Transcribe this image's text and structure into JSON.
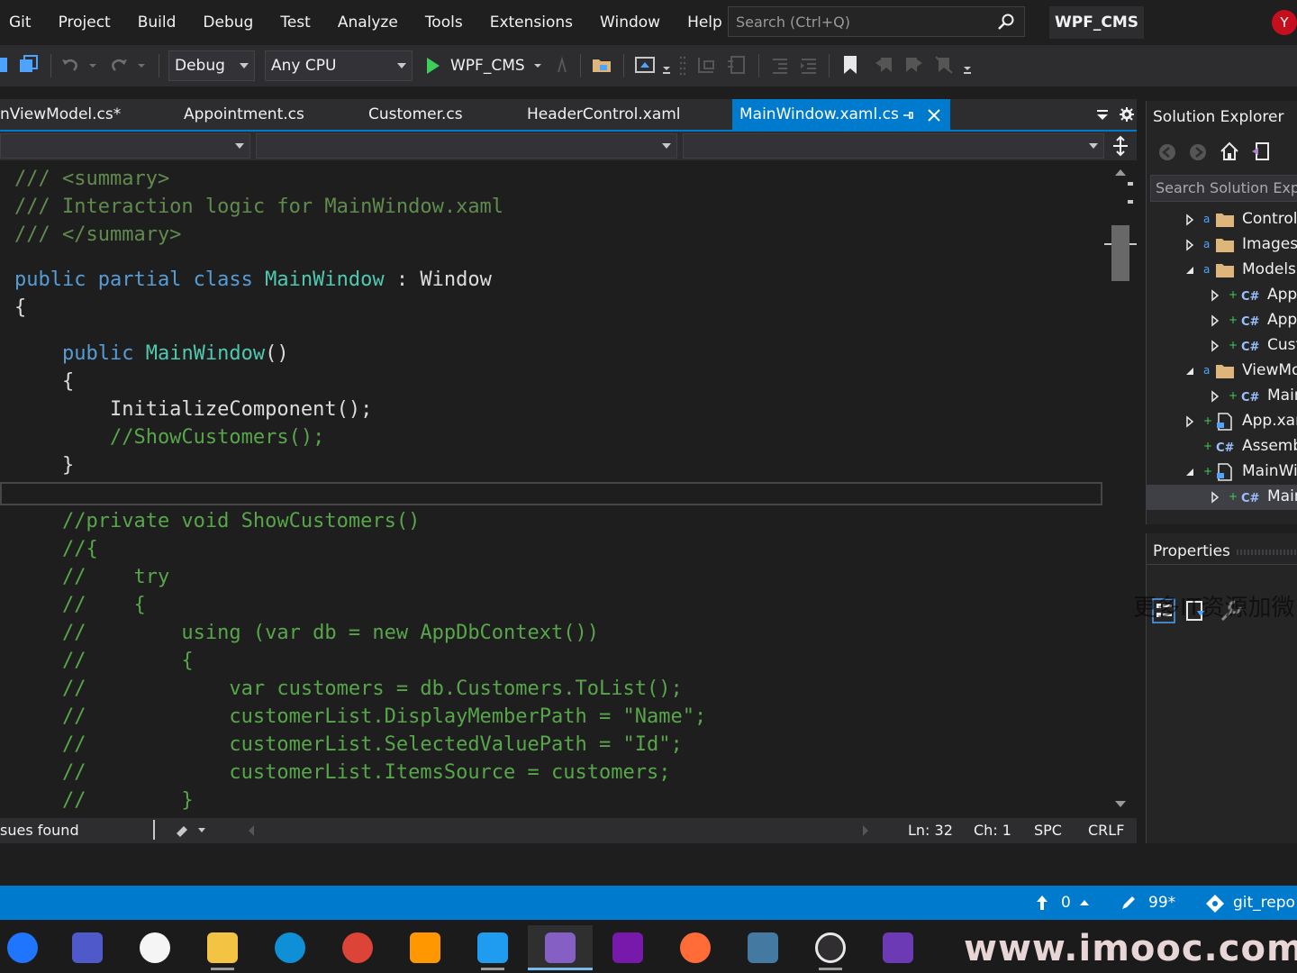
{
  "menu": {
    "items": [
      "Git",
      "Project",
      "Build",
      "Debug",
      "Test",
      "Analyze",
      "Tools",
      "Extensions",
      "Window",
      "Help"
    ],
    "search_placeholder": "Search (Ctrl+Q)",
    "solution_name": "WPF_CMS",
    "user_initial": "Y"
  },
  "toolbar": {
    "configuration": "Debug",
    "platform": "Any CPU",
    "start_label": "WPF_CMS"
  },
  "tabs": [
    {
      "label": "nViewModel.cs*",
      "active": false
    },
    {
      "label": "Appointment.cs",
      "active": false
    },
    {
      "label": "Customer.cs",
      "active": false
    },
    {
      "label": "HeaderControl.xaml",
      "active": false
    },
    {
      "label": "MainWindow.xaml.cs",
      "active": true
    }
  ],
  "code": {
    "l1": "/// <summary>",
    "l2": "/// Interaction logic for MainWindow.xaml",
    "l3": "/// </summary>",
    "l4_kw": "public partial class ",
    "l4_type": "MainWindow",
    "l4_rest": " : Window",
    "l5": "{",
    "l6_kw": "    public ",
    "l6_type": "MainWindow",
    "l6_rest": "()",
    "l7": "    {",
    "l8": "        InitializeComponent();",
    "l9": "        //ShowCustomers();",
    "l10": "    }",
    "l11": "    //private void ShowCustomers()",
    "l12": "    //{",
    "l13": "    //    try",
    "l14": "    //    {",
    "l15": "    //        using (var db = new AppDbContext())",
    "l16": "    //        {",
    "l17": "    //            var customers = db.Customers.ToList();",
    "l18": "    //            customerList.DisplayMemberPath = \"Name\";",
    "l19": "    //            customerList.SelectedValuePath = \"Id\";",
    "l20": "    //            customerList.ItemsSource = customers;",
    "l21": "    //        }"
  },
  "editor_status": {
    "issues": "sues found",
    "line": "Ln: 32",
    "col": "Ch: 1",
    "whitespace": "SPC",
    "line_ending": "CRLF"
  },
  "solution_explorer": {
    "title": "Solution Explorer",
    "search_placeholder": "Search Solution Expl",
    "items": [
      {
        "label": "Controls",
        "kind": "folder",
        "indent": 0,
        "expanded": false
      },
      {
        "label": "Images",
        "kind": "folder",
        "indent": 0,
        "expanded": false
      },
      {
        "label": "Models",
        "kind": "folder",
        "indent": 0,
        "expanded": true
      },
      {
        "label": "App",
        "kind": "cs",
        "indent": 1,
        "expanded": false
      },
      {
        "label": "App",
        "kind": "cs",
        "indent": 1,
        "expanded": false
      },
      {
        "label": "Cust",
        "kind": "cs",
        "indent": 1,
        "expanded": false
      },
      {
        "label": "ViewMo",
        "kind": "folder",
        "indent": 0,
        "expanded": true
      },
      {
        "label": "Main",
        "kind": "cs",
        "indent": 1,
        "expanded": false
      },
      {
        "label": "App.xam",
        "kind": "xaml",
        "indent": 0,
        "expanded": false
      },
      {
        "label": "Assemb",
        "kind": "cs",
        "indent": 0,
        "expanded": null
      },
      {
        "label": "MainWi",
        "kind": "xaml",
        "indent": 0,
        "expanded": true
      },
      {
        "label": "Main",
        "kind": "cs",
        "indent": 1,
        "expanded": false
      }
    ]
  },
  "properties": {
    "title": "Properties",
    "overlay_text": "更多IT资源加微"
  },
  "statusbar": {
    "push_count": "0",
    "changes": "99*",
    "branch": "git_repo"
  },
  "taskbar": {
    "apps": [
      "maps-icon",
      "teams-icon",
      "slack-icon",
      "file-explorer-icon",
      "edge-icon",
      "chrome-icon",
      "sublime-icon",
      "vscode-icon",
      "visual-studio-icon",
      "onenote-icon",
      "postman-icon",
      "mysql-workbench-icon",
      "obs-icon",
      "visual-studio-preview-icon"
    ],
    "watermark": "www.imooc.com"
  },
  "colors": {
    "accent": "#007acc",
    "comment": "#57a64a",
    "keyword": "#569cd6",
    "type": "#4ec9b0"
  }
}
